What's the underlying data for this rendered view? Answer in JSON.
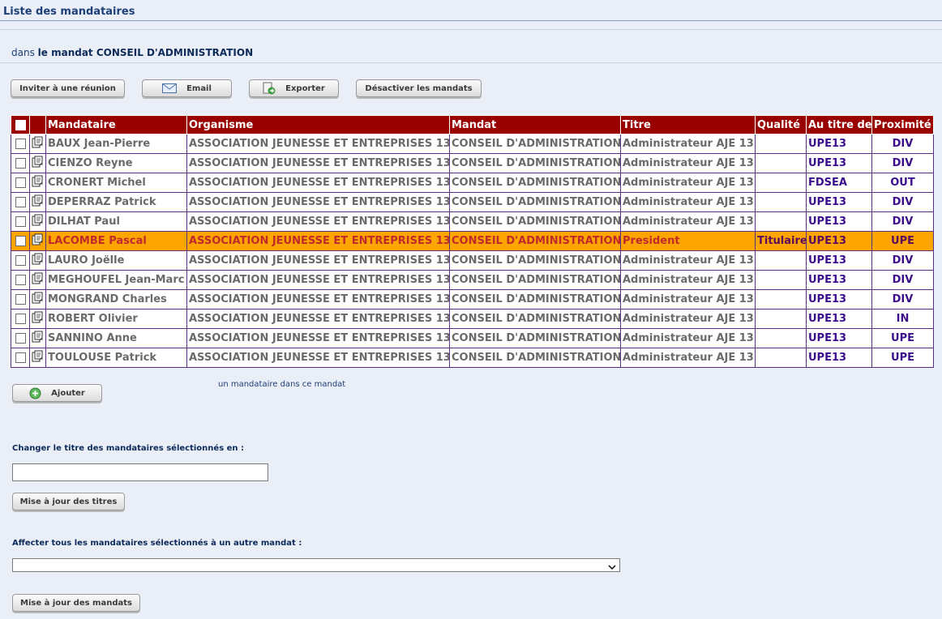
{
  "page": {
    "title": "Liste des mandataires",
    "context_prefix": "dans",
    "context_bold": "le mandat CONSEIL D'ADMINISTRATION"
  },
  "toolbar": {
    "invite_label": "Inviter à une réunion",
    "email_label": "Email",
    "export_label": "Exporter",
    "deactivate_label": "Désactiver les mandats"
  },
  "table": {
    "headers": [
      "Mandataire",
      "Organisme",
      "Mandat",
      "Titre",
      "Qualité",
      "Au titre de",
      "Proximité"
    ],
    "rows": [
      {
        "mandataire": "BAUX Jean-Pierre",
        "organisme": "ASSOCIATION JEUNESSE ET ENTREPRISES 13",
        "mandat": "CONSEIL D'ADMINISTRATION",
        "titre": "Administrateur AJE 13",
        "qualite": "",
        "au_titre_de": "UPE13",
        "proximite": "DIV",
        "selected": false
      },
      {
        "mandataire": "CIENZO Reyne",
        "organisme": "ASSOCIATION JEUNESSE ET ENTREPRISES 13",
        "mandat": "CONSEIL D'ADMINISTRATION",
        "titre": "Administrateur AJE 13",
        "qualite": "",
        "au_titre_de": "UPE13",
        "proximite": "DIV",
        "selected": false
      },
      {
        "mandataire": "CRONERT Michel",
        "organisme": "ASSOCIATION JEUNESSE ET ENTREPRISES 13",
        "mandat": "CONSEIL D'ADMINISTRATION",
        "titre": "Administrateur AJE 13",
        "qualite": "",
        "au_titre_de": "FDSEA",
        "proximite": "OUT",
        "selected": false
      },
      {
        "mandataire": "DEPERRAZ Patrick",
        "organisme": "ASSOCIATION JEUNESSE ET ENTREPRISES 13",
        "mandat": "CONSEIL D'ADMINISTRATION",
        "titre": "Administrateur AJE 13",
        "qualite": "",
        "au_titre_de": "UPE13",
        "proximite": "DIV",
        "selected": false
      },
      {
        "mandataire": "DILHAT Paul",
        "organisme": "ASSOCIATION JEUNESSE ET ENTREPRISES 13",
        "mandat": "CONSEIL D'ADMINISTRATION",
        "titre": "Administrateur AJE 13",
        "qualite": "",
        "au_titre_de": "UPE13",
        "proximite": "DIV",
        "selected": false
      },
      {
        "mandataire": "LACOMBE Pascal",
        "organisme": "ASSOCIATION JEUNESSE ET ENTREPRISES 13",
        "mandat": "CONSEIL D'ADMINISTRATION",
        "titre": "President",
        "qualite": "Titulaire",
        "au_titre_de": "UPE13",
        "proximite": "UPE",
        "selected": true
      },
      {
        "mandataire": "LAURO Joëlle",
        "organisme": "ASSOCIATION JEUNESSE ET ENTREPRISES 13",
        "mandat": "CONSEIL D'ADMINISTRATION",
        "titre": "Administrateur AJE 13",
        "qualite": "",
        "au_titre_de": "UPE13",
        "proximite": "DIV",
        "selected": false
      },
      {
        "mandataire": "MEGHOUFEL Jean-Marc",
        "organisme": "ASSOCIATION JEUNESSE ET ENTREPRISES 13",
        "mandat": "CONSEIL D'ADMINISTRATION",
        "titre": "Administrateur AJE 13",
        "qualite": "",
        "au_titre_de": "UPE13",
        "proximite": "DIV",
        "selected": false
      },
      {
        "mandataire": "MONGRAND Charles",
        "organisme": "ASSOCIATION JEUNESSE ET ENTREPRISES 13",
        "mandat": "CONSEIL D'ADMINISTRATION",
        "titre": "Administrateur AJE 13",
        "qualite": "",
        "au_titre_de": "UPE13",
        "proximite": "DIV",
        "selected": false
      },
      {
        "mandataire": "ROBERT Olivier",
        "organisme": "ASSOCIATION JEUNESSE ET ENTREPRISES 13",
        "mandat": "CONSEIL D'ADMINISTRATION",
        "titre": "Administrateur AJE 13",
        "qualite": "",
        "au_titre_de": "UPE13",
        "proximite": "IN",
        "selected": false
      },
      {
        "mandataire": "SANNINO Anne",
        "organisme": "ASSOCIATION JEUNESSE ET ENTREPRISES 13",
        "mandat": "CONSEIL D'ADMINISTRATION",
        "titre": "Administrateur AJE 13",
        "qualite": "",
        "au_titre_de": "UPE13",
        "proximite": "UPE",
        "selected": false
      },
      {
        "mandataire": "TOULOUSE Patrick",
        "organisme": "ASSOCIATION JEUNESSE ET ENTREPRISES 13",
        "mandat": "CONSEIL D'ADMINISTRATION",
        "titre": "Administrateur AJE 13",
        "qualite": "",
        "au_titre_de": "UPE13",
        "proximite": "UPE",
        "selected": false
      }
    ]
  },
  "add": {
    "button_label": "Ajouter",
    "note": "un mandataire dans ce mandat"
  },
  "title_change": {
    "label": "Changer le titre des mandataires sélectionnés en :",
    "input_value": "",
    "button_label": "Mise à jour des titres"
  },
  "reassign": {
    "label": "Affecter tous les mandataires sélectionnés à un autre mandat :",
    "selected_value": "",
    "button_label": "Mise à jour des mandats"
  },
  "colors": {
    "header_bg": "#990000",
    "selected_row_bg": "#ffa500",
    "page_bg": "#eaeef6",
    "link_purple": "#3b0f8c"
  },
  "icons": {
    "row_icon": "edit-document-icon",
    "email_icon": "envelope-icon",
    "export_icon": "export-icon",
    "add_icon": "plus-circle-icon",
    "select_icon": "chevron-down-icon"
  }
}
